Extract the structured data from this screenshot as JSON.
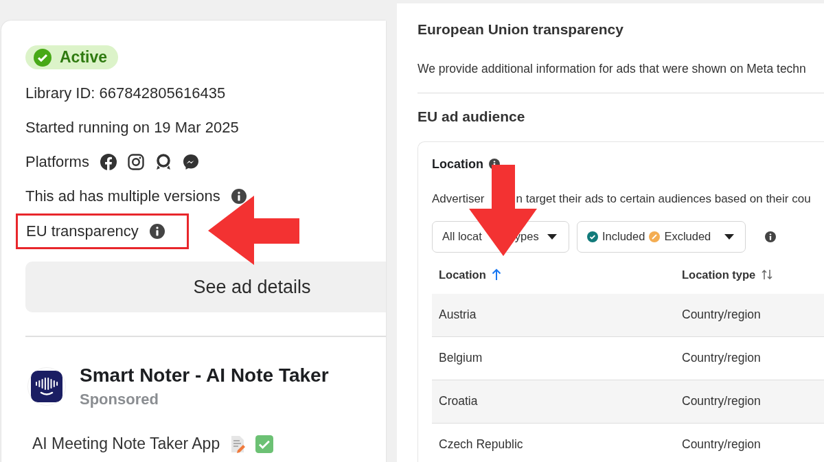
{
  "ad_card": {
    "status": {
      "label": "Active",
      "active": true
    },
    "details": [
      {
        "kind": "text",
        "text": "Library ID: 667842805616435",
        "highlighted": false
      },
      {
        "kind": "text",
        "text": "Started running on 19 Mar 2025",
        "highlighted": false
      },
      {
        "kind": "platforms",
        "text": "Platforms",
        "highlighted": false
      },
      {
        "kind": "info",
        "text": "This ad has multiple versions",
        "highlighted": false
      },
      {
        "kind": "info",
        "text": "EU transparency",
        "highlighted": true
      }
    ],
    "details_button": "See ad details",
    "advertiser": {
      "name": "Smart Noter - AI Note Taker",
      "subtitle": "Sponsored"
    },
    "body": "AI Meeting Note Taker App"
  },
  "transparency": {
    "title": "European Union transparency",
    "description": "We provide additional information for ads that were shown on Meta techn",
    "section_title": "EU ad audience",
    "location": {
      "title": "Location",
      "description": [
        "Advertiser",
        "n target their ads to certain audiences based on their cou"
      ],
      "filters": [
        {
          "kind": "dropdown",
          "label": [
            "All locat",
            "ypes"
          ]
        },
        {
          "kind": "legend",
          "items": [
            {
              "label": "Included",
              "color": "#117a7a"
            },
            {
              "label": "Excluded",
              "color": "#f4ad52"
            }
          ]
        }
      ],
      "table": {
        "columns": [
          {
            "label": "Location",
            "sorted": true
          },
          {
            "label": "Location type",
            "sorted": false
          }
        ],
        "rows": [
          [
            "Austria",
            "Country/region"
          ],
          [
            "Belgium",
            "Country/region"
          ],
          [
            "Croatia",
            "Country/region"
          ],
          [
            "Czech Republic",
            "Country/region"
          ]
        ]
      }
    }
  }
}
